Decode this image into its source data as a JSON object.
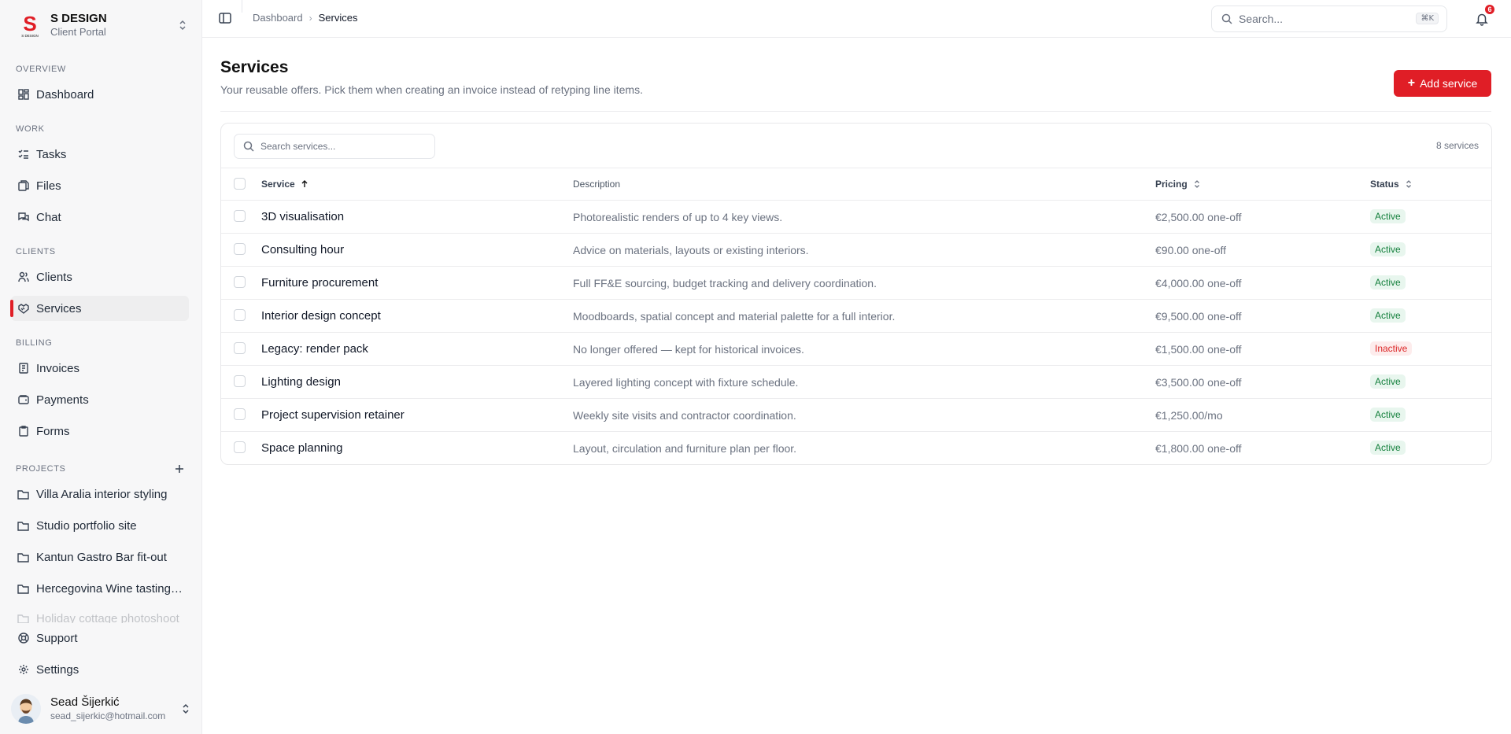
{
  "brand": {
    "name": "S DESIGN",
    "subtitle": "Client Portal",
    "logo_letter": "S",
    "logo_caption": "S DESIGN",
    "accent": "#e01e26"
  },
  "sidebar": {
    "sections": {
      "overview": "OVERVIEW",
      "work": "WORK",
      "clients": "CLIENTS",
      "billing": "BILLING",
      "projects": "PROJECTS"
    },
    "items": {
      "dashboard": "Dashboard",
      "tasks": "Tasks",
      "files": "Files",
      "chat": "Chat",
      "clients": "Clients",
      "services": "Services",
      "invoices": "Invoices",
      "payments": "Payments",
      "forms": "Forms"
    },
    "projects": [
      "Villa Aralia interior styling",
      "Studio portfolio site",
      "Kantun Gastro Bar fit-out",
      "Hercegovina Wine tasting room",
      "Holiday cottage photoshoot"
    ],
    "footer": {
      "support": "Support",
      "settings": "Settings"
    },
    "user": {
      "name": "Sead Šijerkić",
      "email": "sead_sijerkic@hotmail.com"
    },
    "active_item": "services"
  },
  "topbar": {
    "breadcrumb": [
      "Dashboard",
      "Services"
    ],
    "search_placeholder": "Search...",
    "search_shortcut": "⌘K",
    "notification_count": "6"
  },
  "page": {
    "title": "Services",
    "subtitle": "Your reusable offers. Pick them when creating an invoice instead of retyping line items.",
    "add_button": "Add service"
  },
  "table": {
    "search_placeholder": "Search services...",
    "count_label": "8 services",
    "columns": {
      "service": "Service",
      "description": "Description",
      "pricing": "Pricing",
      "status": "Status"
    },
    "rows": [
      {
        "name": "3D visualisation",
        "description": "Photorealistic renders of up to 4 key views.",
        "pricing": "€2,500.00 one-off",
        "status": "Active"
      },
      {
        "name": "Consulting hour",
        "description": "Advice on materials, layouts or existing interiors.",
        "pricing": "€90.00 one-off",
        "status": "Active"
      },
      {
        "name": "Furniture procurement",
        "description": "Full FF&E sourcing, budget tracking and delivery coordination.",
        "pricing": "€4,000.00 one-off",
        "status": "Active"
      },
      {
        "name": "Interior design concept",
        "description": "Moodboards, spatial concept and material palette for a full interior.",
        "pricing": "€9,500.00 one-off",
        "status": "Active"
      },
      {
        "name": "Legacy: render pack",
        "description": "No longer offered — kept for historical invoices.",
        "pricing": "€1,500.00 one-off",
        "status": "Inactive"
      },
      {
        "name": "Lighting design",
        "description": "Layered lighting concept with fixture schedule.",
        "pricing": "€3,500.00 one-off",
        "status": "Active"
      },
      {
        "name": "Project supervision retainer",
        "description": "Weekly site visits and contractor coordination.",
        "pricing": "€1,250.00/mo",
        "status": "Active"
      },
      {
        "name": "Space planning",
        "description": "Layout, circulation and furniture plan per floor.",
        "pricing": "€1,800.00 one-off",
        "status": "Active"
      }
    ]
  }
}
